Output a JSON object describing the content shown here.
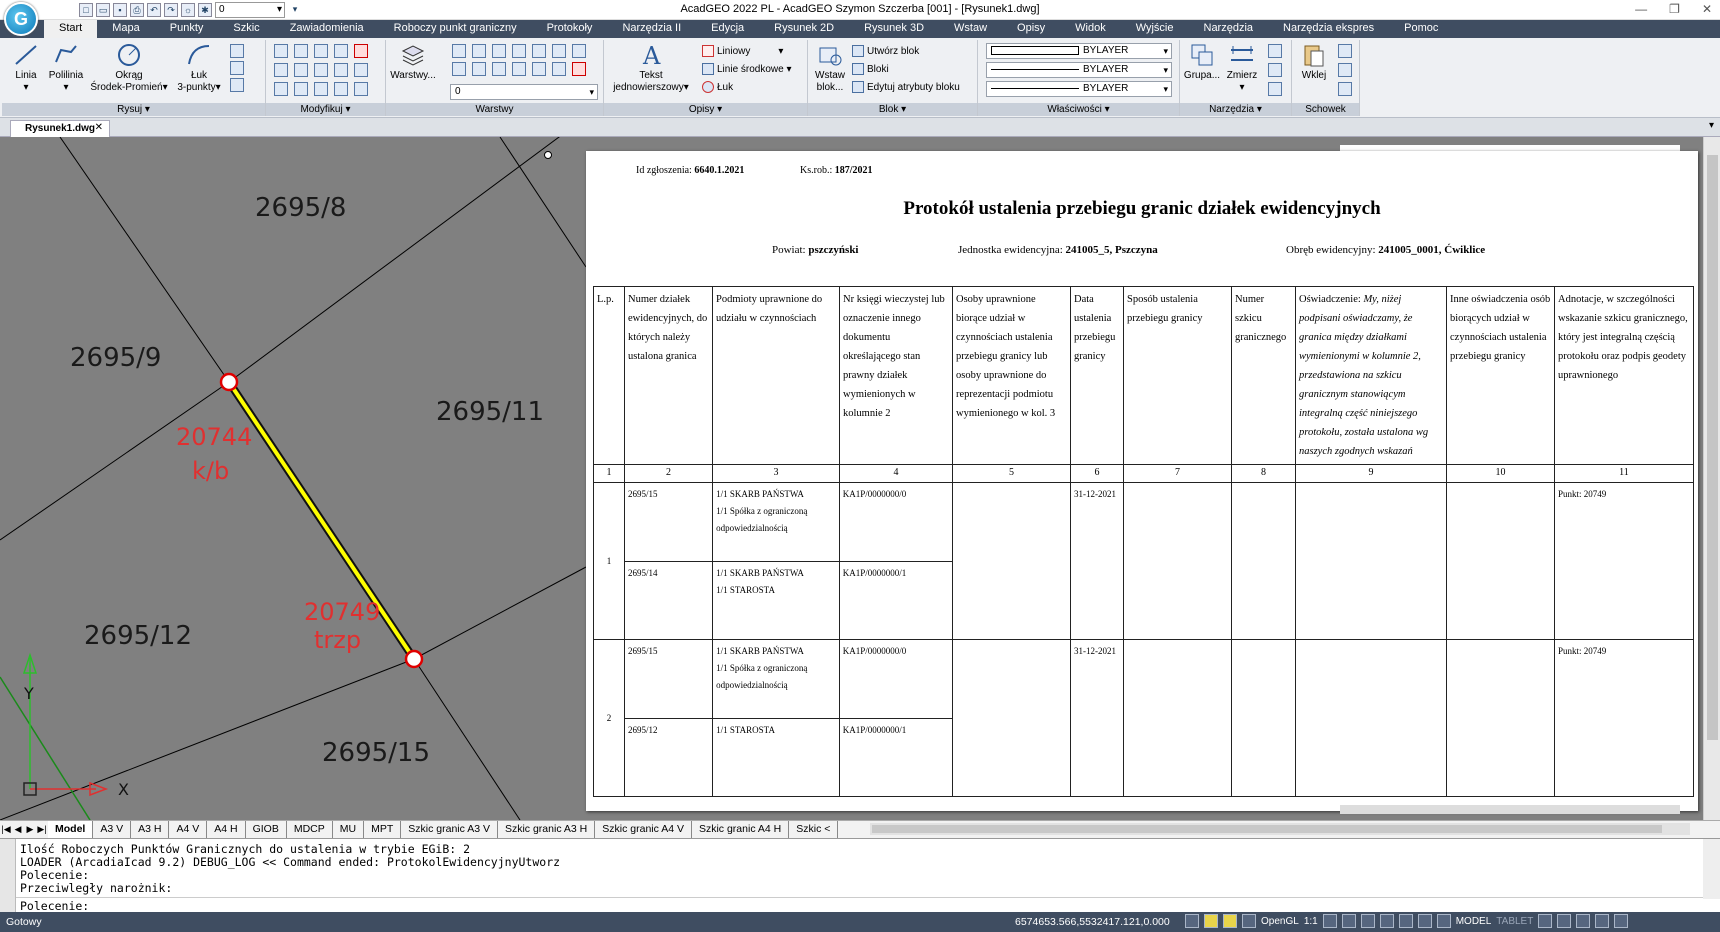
{
  "window": {
    "title": "AcadGEO 2022 PL - AcadGEO Szymon Szczerba [001] - [Rysunek1.dwg]",
    "layer_value": "0"
  },
  "menu": [
    "Start",
    "Mapa",
    "Punkty",
    "Szkic",
    "Zawiadomienia",
    "Roboczy punkt graniczny",
    "Protokoły",
    "Narzędzia II",
    "Edycja",
    "Rysunek 2D",
    "Rysunek 3D",
    "Wstaw",
    "Opisy",
    "Widok",
    "Wyjście",
    "Narzędzia",
    "Narzędzia ekspres",
    "Pomoc"
  ],
  "ribbon": {
    "rysuj": {
      "title": "Rysuj ▾",
      "linia": "Linia",
      "polilinia": "Polilinia",
      "okrag": "Okrąg",
      "okrag2": "Środek-Promień▾",
      "luk": "Łuk",
      "luk2": "3-punkty▾"
    },
    "modyfikuj": {
      "title": "Modyfikuj ▾"
    },
    "warstwy": {
      "title": "Warstwy",
      "button": "Warstwy...",
      "layer": "0"
    },
    "opisy": {
      "title": "Opisy ▾",
      "tekst": "Tekst",
      "tekst2": "jednowierszowy▾",
      "liniowy": "Liniowy",
      "linie_srodkowe": "Linie środkowe",
      "luk": "Łuk"
    },
    "blok": {
      "title": "Blok ▾",
      "wstaw": "Wstaw",
      "wstaw2": "blok...",
      "utworz": "Utwórz blok",
      "bloki": "Bloki",
      "edytuj": "Edytuj atrybuty bloku"
    },
    "wlasciwosci": {
      "title": "Właściwości ▾",
      "v1": "BYLAYER",
      "v2": "BYLAYER",
      "v3": "BYLAYER"
    },
    "narzedzia": {
      "title": "Narzędzia ▾",
      "grupa": "Grupa...",
      "zmierz": "Zmierz"
    },
    "schowek": {
      "title": "Schowek",
      "wklej": "Wklej"
    }
  },
  "doc_tab": "Rysunek1.dwg",
  "drawing": {
    "parcels": [
      "2695/8",
      "2695/9",
      "2695/11",
      "2695/12",
      "2695/15"
    ],
    "point1_num": "20744",
    "point1_code": "k/b",
    "point2_num": "20749",
    "point2_code": "trzp",
    "axis_y": "Y",
    "axis_x": "X"
  },
  "protocol": {
    "id_label": "Id zgłoszenia:",
    "id_value": "6640.1.2021",
    "ks_label": "Ks.rob.:",
    "ks_value": "187/2021",
    "title": "Protokół ustalenia przebiegu granic działek ewidencyjnych",
    "powiat_label": "Powiat:",
    "powiat_value": "pszczyński",
    "jednostka_label": "Jednostka ewidencyjna:",
    "jednostka_value": "241005_5, Pszczyna",
    "obreb_label": "Obręb ewidencyjny:",
    "obreb_value": "241005_0001, Ćwiklice",
    "headers": {
      "c1": "L.p.",
      "c2": "Numer działek ewidencyjnych, do których należy ustalona granica",
      "c3": "Podmioty uprawnione do udziału w czynnościach",
      "c4": "Nr księgi wieczystej lub oznaczenie innego dokumentu określającego stan prawny działek wymienionych w kolumnie 2",
      "c5": "Osoby uprawnione biorące udział w czynnościach ustalenia przebiegu granicy lub osoby uprawnione do reprezentacji podmiotu wymienionego w kol. 3",
      "c6": "Data ustalenia przebiegu granicy",
      "c7": "Sposób ustalenia przebiegu granicy",
      "c8": "Numer szkicu granicznego",
      "c9a": "Oświadczenie: ",
      "c9b": "My, niżej podpisani oświadczamy, że granica między działkami wymienionymi w kolumnie 2, przedstawiona na szkicu granicznym stanowiącym integralną część niniejszego protokołu, została ustalona wg naszych zgodnych wskazań",
      "c10": "Inne oświadczenia osób biorących udział w czynnościach ustalenia przebiegu granicy",
      "c11": "Adnotacje, w szczególności wskazanie szkicu granicznego, który jest integralną częścią protokołu oraz podpis geodety uprawnionego"
    },
    "col_numbers": [
      "1",
      "2",
      "3",
      "4",
      "5",
      "6",
      "7",
      "8",
      "9",
      "10",
      "11"
    ],
    "rows": [
      {
        "lp": "1",
        "date": "31-12-2021",
        "note": "Punkt: 20749",
        "parcels": [
          {
            "num": "2695/15",
            "owner1": "1/1 SKARB PAŃSTWA",
            "owner2": "1/1 Spółka z ograniczoną odpowiedzialnością",
            "kw": "KA1P/0000000/0"
          },
          {
            "num": "2695/14",
            "owner1": "1/1 SKARB PAŃSTWA",
            "owner2": "1/1 STAROSTA",
            "kw": "KA1P/0000000/1"
          }
        ]
      },
      {
        "lp": "2",
        "date": "31-12-2021",
        "note": "Punkt: 20749",
        "parcels": [
          {
            "num": "2695/15",
            "owner1": "1/1 SKARB PAŃSTWA",
            "owner2": "1/1 Spółka z ograniczoną odpowiedzialnością",
            "kw": "KA1P/0000000/0"
          },
          {
            "num": "2695/12",
            "owner1": "1/1 STAROSTA",
            "owner2": "",
            "kw": "KA1P/0000000/1"
          }
        ]
      }
    ]
  },
  "layout_tabs": [
    "Model",
    "A3 V",
    "A3 H",
    "A4 V",
    "A4 H",
    "GIOB",
    "MDCP",
    "MU",
    "MPT",
    "Szkic granic A3 V",
    "Szkic granic A3 H",
    "Szkic granic A4 V",
    "Szkic granic A4 H",
    "Szkic <"
  ],
  "command": {
    "l1": "Ilość Roboczych Punktów Granicznych do ustalenia w trybie EGiB: 2",
    "l2": "LOADER (ArcadiaIcad 9.2) DEBUG_LOG << Command ended: ProtokolEwidencyjnyUtworz",
    "l3": "Polecenie:",
    "l4": "Przeciwległy narożnik:",
    "prompt": "Polecenie:"
  },
  "status": {
    "ready": "Gotowy",
    "coords": "6574653.566,5532417.121,0.000",
    "opengl": "OpenGL",
    "scale": "1:1",
    "model": "MODEL",
    "tablet": "TABLET"
  }
}
